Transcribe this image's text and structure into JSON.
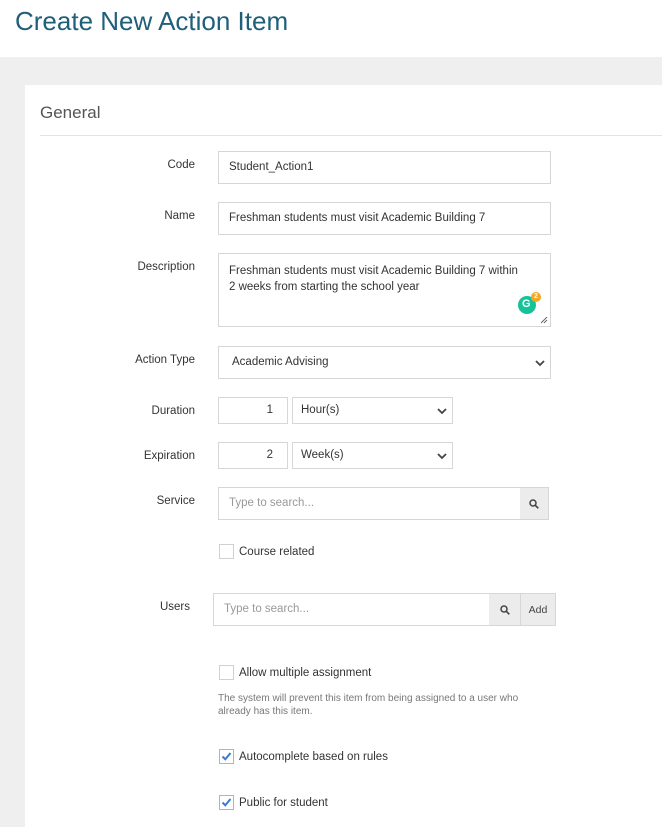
{
  "page": {
    "title": "Create New Action Item"
  },
  "section": {
    "title": "General"
  },
  "form": {
    "code": {
      "label": "Code",
      "value": "Student_Action1"
    },
    "name": {
      "label": "Name",
      "value": "Freshman students must visit Academic Building 7"
    },
    "description": {
      "label": "Description",
      "value": "Freshman students must visit Academic Building 7 within 2 weeks from starting the school year"
    },
    "action_type": {
      "label": "Action Type",
      "selected": "Academic Advising"
    },
    "duration": {
      "label": "Duration",
      "number": "1",
      "unit": "Hour(s)"
    },
    "expiration": {
      "label": "Expiration",
      "number": "2",
      "unit": "Week(s)"
    },
    "service": {
      "label": "Service",
      "placeholder": "Type to search..."
    },
    "course_related": {
      "label": "Course related",
      "checked": false
    },
    "users": {
      "label": "Users",
      "placeholder": "Type to search...",
      "add_label": "Add"
    },
    "allow_multiple": {
      "label": "Allow multiple assignment",
      "checked": false,
      "help": "The system will prevent this item from being assigned to a user who already has this item."
    },
    "autocomplete": {
      "label": "Autocomplete based on rules",
      "checked": true
    },
    "public_for_student": {
      "label": "Public for student",
      "checked": true
    }
  },
  "grammarly": {
    "badge_count": "2"
  },
  "colors": {
    "title": "#1f5f7a",
    "check": "#3a7bd5",
    "grammarly": "#15c39a"
  },
  "icons": [
    "chevron-down-icon",
    "search-icon",
    "check-icon",
    "grammarly-icon",
    "resize-grip-icon"
  ]
}
